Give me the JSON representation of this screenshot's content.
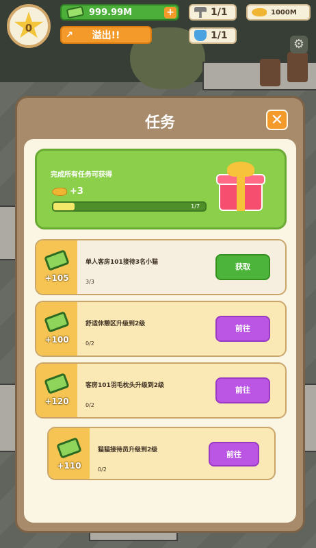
{
  "hud": {
    "level": "0",
    "money": "999.99M",
    "overflow_label": "溢出!!",
    "hammer_count": "1/1",
    "fish_amount": "1000M",
    "flask_count": "1/1"
  },
  "panel": {
    "title": "任务",
    "close_icon": "close-icon"
  },
  "banner": {
    "text": "完成所有任务可获得",
    "reward": "+3",
    "progress_text": "1/7",
    "progress_fraction": 0.14
  },
  "tasks": [
    {
      "reward": "+105",
      "name": "单人客房101接待3名小猫",
      "count": "3/3",
      "button": "获取",
      "state": "done"
    },
    {
      "reward": "+100",
      "name": "舒适休憩区升级到2级",
      "count": "0/2",
      "button": "前往",
      "state": "todo"
    },
    {
      "reward": "+120",
      "name": "客房101羽毛枕头升级到2级",
      "count": "0/2",
      "button": "前往",
      "state": "todo"
    },
    {
      "reward": "+110",
      "name": "猫猫接待员升级到2级",
      "count": "0/2",
      "button": "前往",
      "state": "todo"
    }
  ],
  "colors": {
    "accent_orange": "#f39a2b",
    "green_button": "#4cb43a",
    "purple_button": "#bb55e3",
    "panel_brown": "#a88b6a"
  }
}
